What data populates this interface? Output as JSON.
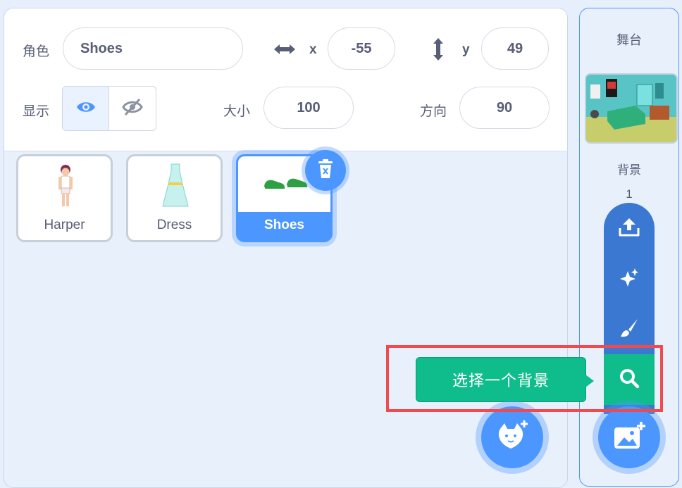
{
  "sprite_info": {
    "sprite_label": "角色",
    "sprite_name": "Shoes",
    "x_label": "x",
    "x_value": "-55",
    "y_label": "y",
    "y_value": "49",
    "show_label": "显示",
    "size_label": "大小",
    "size_value": "100",
    "direction_label": "方向",
    "direction_value": "90"
  },
  "sprites": [
    {
      "name": "Harper",
      "selected": false
    },
    {
      "name": "Dress",
      "selected": false
    },
    {
      "name": "Shoes",
      "selected": true
    }
  ],
  "stage": {
    "title": "舞台",
    "backdrop_label": "背景",
    "backdrop_count": "1"
  },
  "backdrop_menu": {
    "items": [
      "upload-icon",
      "surprise-icon",
      "paint-icon",
      "search-icon"
    ],
    "tooltip": "选择一个背景"
  },
  "colors": {
    "accent": "#4c97ff",
    "menu": "#3a78d1",
    "tooltip_green": "#0fbd8c",
    "highlight_red": "#f04a4e"
  }
}
